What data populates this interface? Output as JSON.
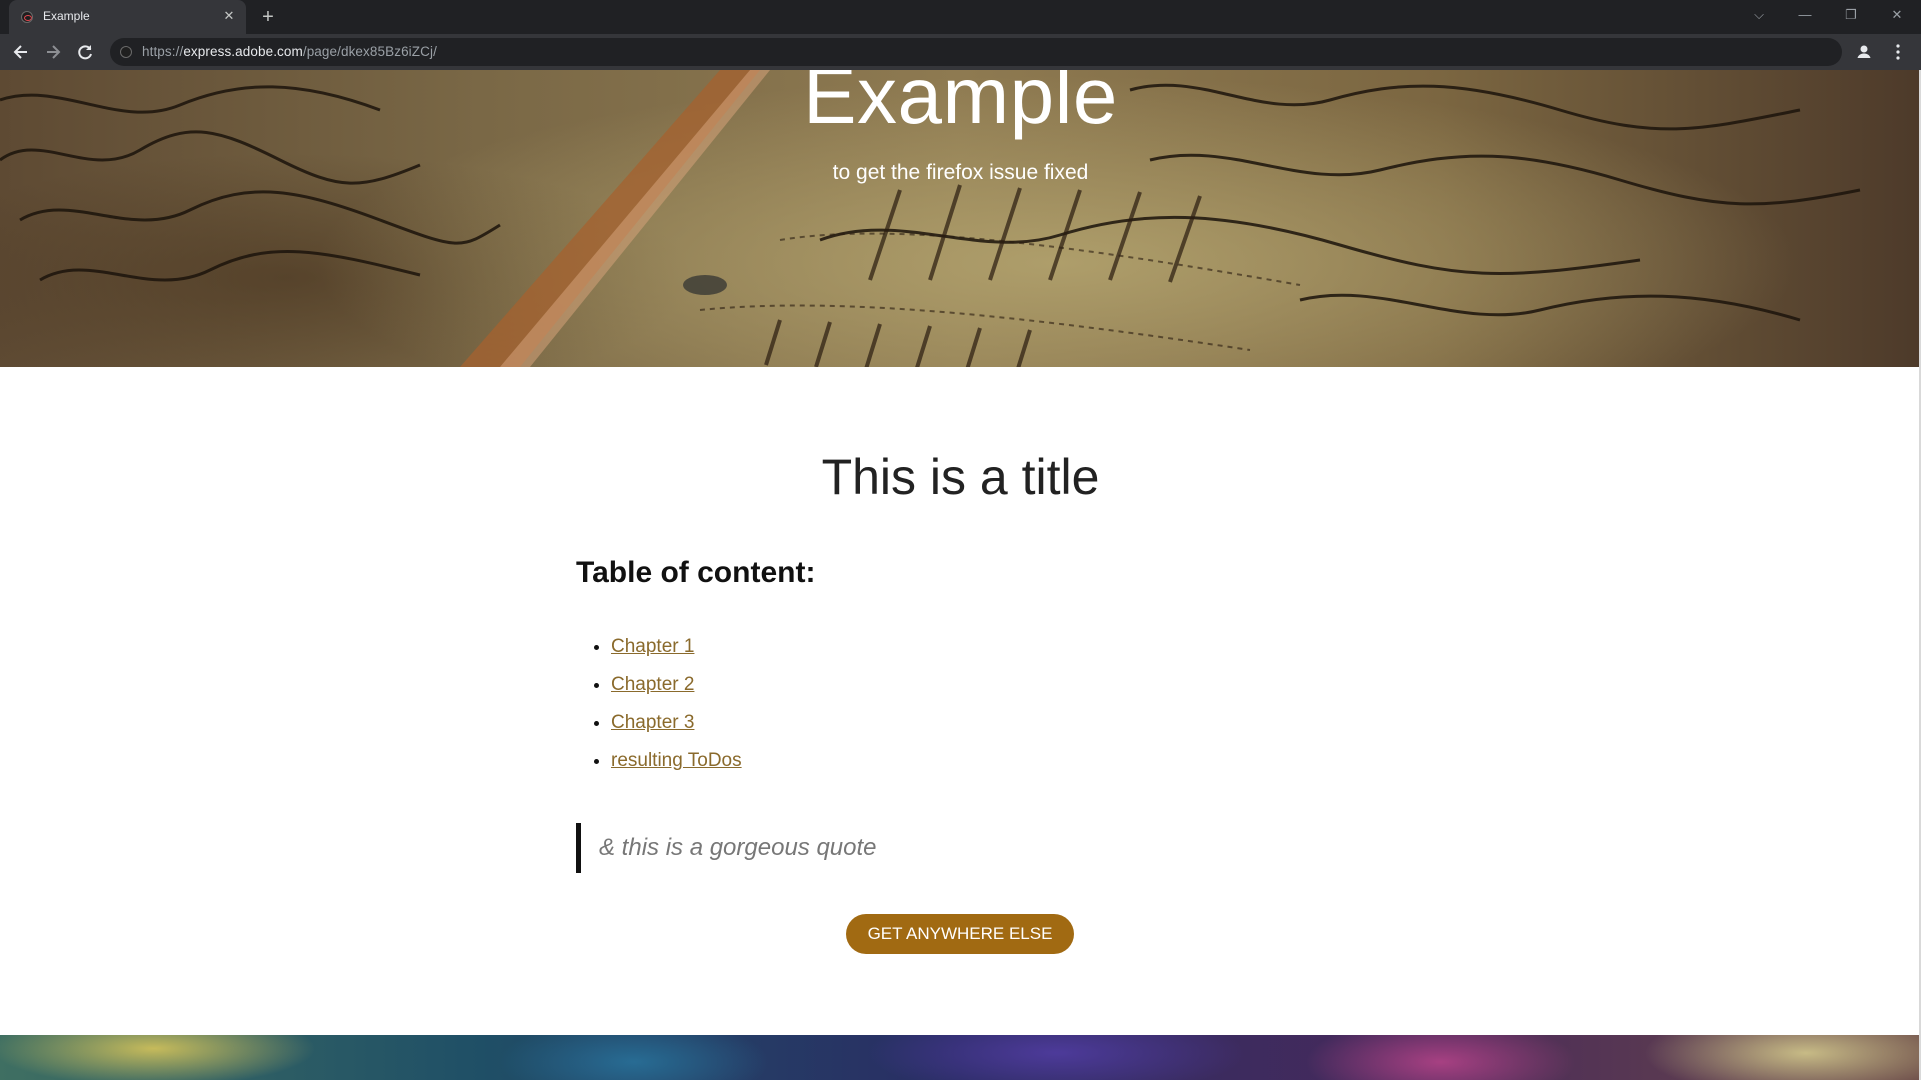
{
  "browser": {
    "tab_title": "Example",
    "tab_close_glyph": "✕",
    "new_tab_glyph": "+",
    "url_scheme": "https://",
    "url_host": "express.adobe.com",
    "url_path": "/page/dkex85Bz6iZCj/",
    "window_controls": [
      "⌵",
      "—",
      "❐",
      "✕"
    ],
    "icons": [
      "back-icon",
      "forward-icon",
      "reload-icon",
      "site-info-icon",
      "profile-icon",
      "menu-icon"
    ]
  },
  "hero": {
    "title": "Example",
    "subtitle": "to get the firefox issue fixed"
  },
  "content": {
    "title": "This is a title",
    "toc_heading": "Table of content:",
    "toc_items": [
      "Chapter 1",
      "Chapter 2",
      "Chapter 3",
      "resulting ToDos"
    ],
    "quote": "& this is a gorgeous quote",
    "cta_label": "GET ANYWHERE ELSE"
  },
  "colors": {
    "link": "#8a6a2c",
    "cta_background": "#a16a12",
    "quote_text": "#777777",
    "chrome_dark": "#202124",
    "chrome_toolbar": "#35363a"
  }
}
